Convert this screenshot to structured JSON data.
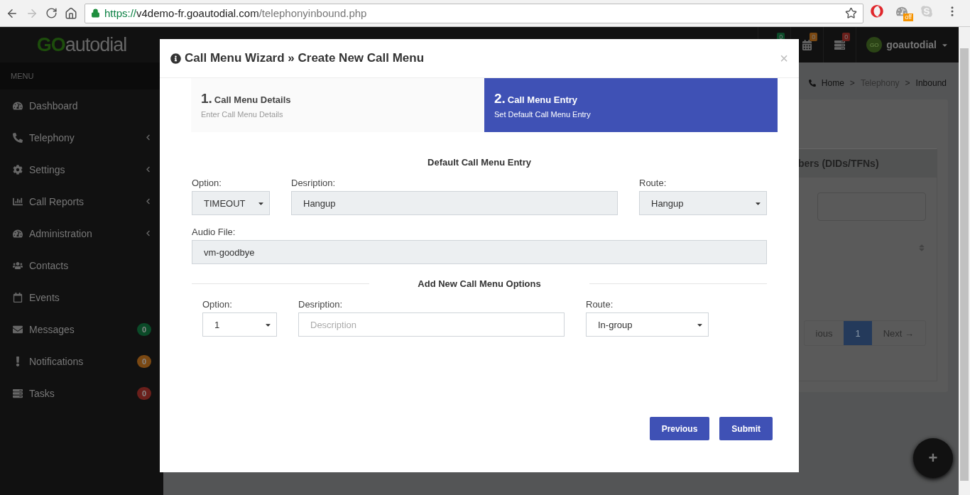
{
  "browser": {
    "url_scheme": "https://",
    "url_host": "v4demo-fr.goautodial.com",
    "url_path": "/telephonyinbound.php",
    "extension_badge": "off"
  },
  "sidebar": {
    "logo_prefix": "GO",
    "logo_rest": "autodial",
    "menu_label": "MENU",
    "items": [
      {
        "label": "Dashboard",
        "submenu": false
      },
      {
        "label": "Telephony",
        "submenu": true
      },
      {
        "label": "Settings",
        "submenu": true
      },
      {
        "label": "Call Reports",
        "submenu": true
      },
      {
        "label": "Administration",
        "submenu": true
      },
      {
        "label": "Contacts",
        "submenu": false
      },
      {
        "label": "Events",
        "submenu": false
      },
      {
        "label": "Messages",
        "submenu": false,
        "badge": "0",
        "color": "#0b4a28"
      },
      {
        "label": "Notifications",
        "submenu": false,
        "badge": "0",
        "color": "#7a4812"
      },
      {
        "label": "Tasks",
        "submenu": false,
        "badge": "0",
        "color": "#6a1f1b"
      }
    ]
  },
  "header": {
    "notices": [
      {
        "badge": "0",
        "color": "#0b4a28"
      },
      {
        "badge": "0",
        "color": "#7a4812"
      },
      {
        "badge": "0",
        "color": "#6a1f1b"
      }
    ],
    "avatar": "GO",
    "user": "goautodial"
  },
  "breadcrumb": [
    {
      "label": "Home"
    },
    {
      "separator": ">",
      "label": "Telephony"
    },
    {
      "separator": ">",
      "label": "Inbound"
    }
  ],
  "panel": {
    "title": "bers (DIDs/TFNs)",
    "pager": [
      {
        "label": "ious",
        "selected": false
      },
      {
        "label": "1",
        "selected": true
      },
      {
        "label": "Next →",
        "selected": false
      }
    ]
  },
  "modal": {
    "title": "Call Menu Wizard » Create New Call Menu",
    "close": "×",
    "steps": [
      {
        "number": "1.",
        "title": "Call Menu Details",
        "subtitle": "Enter Call Menu Details",
        "selected": false
      },
      {
        "number": "2.",
        "title": "Call Menu Entry",
        "subtitle": "Set Default Call Menu Entry",
        "selected": true
      }
    ],
    "default_entry": {
      "heading": "Default Call Menu Entry",
      "option": {
        "label": "Option:",
        "value": "TIMEOUT"
      },
      "description": {
        "label": "Desription:",
        "value": "Hangup"
      },
      "route": {
        "label": "Route:",
        "value": "Hangup"
      },
      "audio_file": {
        "label": "Audio File:",
        "value": "vm-goodbye"
      }
    },
    "new_options": {
      "heading": "Add New Call Menu Options",
      "option": {
        "label": "Option:",
        "value": "1"
      },
      "description": {
        "label": "Desription:",
        "placeholder": "Description"
      },
      "route": {
        "label": "Route:",
        "value": "In-group"
      }
    },
    "buttons": [
      "Previous",
      "Submit"
    ]
  },
  "fab": "+"
}
